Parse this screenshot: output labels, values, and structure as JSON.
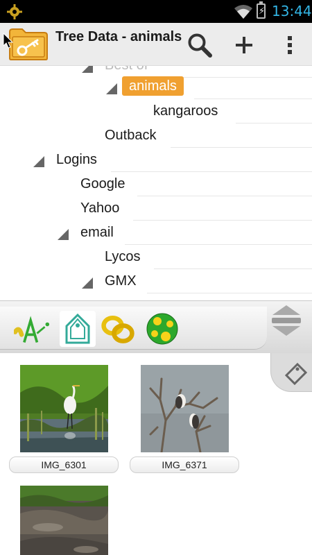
{
  "status_bar": {
    "time": "13:44"
  },
  "action_bar": {
    "title": "Tree Data - animals",
    "search_icon": "search-icon",
    "add_icon": "plus-icon",
    "more_icon": "overflow-menu-icon"
  },
  "tree": {
    "items": [
      {
        "label": "Best of",
        "expanded": true
      },
      {
        "label": "animals",
        "expanded": true,
        "selected": true
      },
      {
        "label": "kangaroos",
        "expanded": false
      },
      {
        "label": "Outback",
        "expanded": false
      },
      {
        "label": "Logins",
        "expanded": true
      },
      {
        "label": "Google",
        "expanded": false
      },
      {
        "label": "Yahoo",
        "expanded": false
      },
      {
        "label": "email",
        "expanded": true
      },
      {
        "label": "Lycos",
        "expanded": false
      },
      {
        "label": "GMX",
        "expanded": true
      }
    ]
  },
  "tabs": [
    {
      "icon": "text-attribute-icon"
    },
    {
      "icon": "tag-icon",
      "active": true
    },
    {
      "icon": "link-rings-icon"
    },
    {
      "icon": "green-dotted-ball-icon"
    }
  ],
  "gallery": {
    "images": [
      {
        "caption": "IMG_6301",
        "subject": "egret-in-marsh"
      },
      {
        "caption": "IMG_6371",
        "subject": "birds-on-dead-tree"
      },
      {
        "caption": "",
        "subject": "mud-and-grass"
      }
    ]
  }
}
